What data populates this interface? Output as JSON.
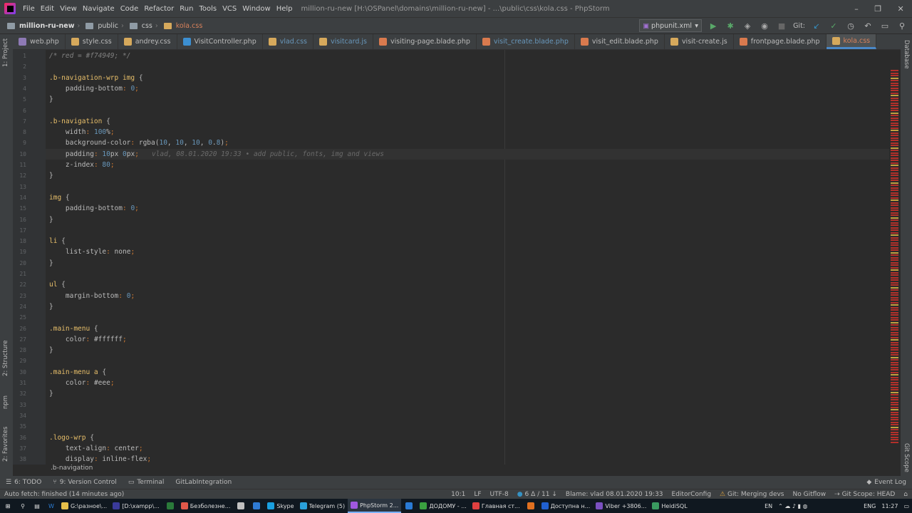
{
  "window": {
    "title": "million-ru-new [H:\\OSPanel\\domains\\million-ru-new] - ...\\public\\css\\kola.css - PhpStorm",
    "controls": [
      "–",
      "❐",
      "✕"
    ]
  },
  "menu": [
    "File",
    "Edit",
    "View",
    "Navigate",
    "Code",
    "Refactor",
    "Run",
    "Tools",
    "VCS",
    "Window",
    "Help"
  ],
  "breadcrumb": {
    "project": "million-ru-new",
    "dir1": "public",
    "dir2": "css",
    "file": "kola.css"
  },
  "run_config": {
    "label": "phpunit.xml",
    "git_label": "Git:"
  },
  "tabs": [
    {
      "label": "web.php",
      "color": "#8e7ab5"
    },
    {
      "label": "style.css",
      "color": "#d6a95c"
    },
    {
      "label": "andrey.css",
      "color": "#d6a95c"
    },
    {
      "label": "VisitController.php",
      "color": "#3c8fd1"
    },
    {
      "label": "vlad.css",
      "color": "#d6a95c"
    },
    {
      "label": "visitcard.js",
      "color": "#d6a95c"
    },
    {
      "label": "visiting-page.blade.php",
      "color": "#d97a4e"
    },
    {
      "label": "visit_create.blade.php",
      "color": "#d97a4e"
    },
    {
      "label": "visit_edit.blade.php",
      "color": "#d97a4e"
    },
    {
      "label": "visit-create.js",
      "color": "#d6a95c"
    },
    {
      "label": "frontpage.blade.php",
      "color": "#d97a4e"
    },
    {
      "label": "kola.css",
      "color": "#d6a95c"
    }
  ],
  "tab_colors": {
    "active_text": "#d9825b",
    "modified_text": "#6897bb"
  },
  "left_tools": [
    "1: Project",
    "2: Structure",
    "npm",
    "2: Favorites"
  ],
  "right_tools": [
    "Database",
    "Git Scope"
  ],
  "code_lines": [
    {
      "n": "1",
      "t": "/* red = #f74949; */"
    },
    {
      "n": "2",
      "t": ""
    },
    {
      "n": "3",
      "t": ".b-navigation-wrp img {"
    },
    {
      "n": "4",
      "t": "    padding-bottom: 0;"
    },
    {
      "n": "5",
      "t": "}"
    },
    {
      "n": "6",
      "t": ""
    },
    {
      "n": "7",
      "t": ".b-navigation {"
    },
    {
      "n": "8",
      "t": "    width: 100%;"
    },
    {
      "n": "9",
      "t": "    background-color: rgba(10, 10, 10, 0.8);"
    },
    {
      "n": "10",
      "t": "    padding: 10px 0px;",
      "blame": "vlad, 08.01.2020 19:33 • add public, fonts, img and views"
    },
    {
      "n": "11",
      "t": "    z-index: 80;"
    },
    {
      "n": "12",
      "t": "}"
    },
    {
      "n": "13",
      "t": ""
    },
    {
      "n": "14",
      "t": "img {"
    },
    {
      "n": "15",
      "t": "    padding-bottom: 0;"
    },
    {
      "n": "16",
      "t": "}"
    },
    {
      "n": "17",
      "t": ""
    },
    {
      "n": "18",
      "t": "li {"
    },
    {
      "n": "19",
      "t": "    list-style: none;"
    },
    {
      "n": "20",
      "t": "}"
    },
    {
      "n": "21",
      "t": ""
    },
    {
      "n": "22",
      "t": "ul {"
    },
    {
      "n": "23",
      "t": "    margin-bottom: 0;"
    },
    {
      "n": "24",
      "t": "}"
    },
    {
      "n": "25",
      "t": ""
    },
    {
      "n": "26",
      "t": ".main-menu {"
    },
    {
      "n": "27",
      "t": "    color: #ffffff;"
    },
    {
      "n": "28",
      "t": "}"
    },
    {
      "n": "29",
      "t": ""
    },
    {
      "n": "30",
      "t": ".main-menu a {"
    },
    {
      "n": "31",
      "t": "    color: #eee;"
    },
    {
      "n": "32",
      "t": "}"
    },
    {
      "n": "33",
      "t": ""
    },
    {
      "n": "34",
      "t": ""
    },
    {
      "n": "35",
      "t": ""
    },
    {
      "n": "36",
      "t": ".logo-wrp {"
    },
    {
      "n": "37",
      "t": "    text-align: center;"
    },
    {
      "n": "38",
      "t": "    display: inline-flex;"
    }
  ],
  "breadcrumb_context": ".b-navigation",
  "bottom_tools": [
    "6: TODO",
    "9: Version Control",
    "Terminal",
    "GitLabIntegration"
  ],
  "event_log": "Event Log",
  "status": {
    "message": "Auto fetch: finished (14 minutes ago)",
    "position": "10:1",
    "line_sep": "LF",
    "encoding": "UTF-8",
    "changes": "6 Δ / 11 ↓",
    "blame": "Blame: vlad 08.01.2020 19:33",
    "editorconfig": "EditorConfig",
    "git": "Git: Merging devs",
    "gitflow": "No Gitflow",
    "scope": "Git Scope: HEAD"
  },
  "taskbar": {
    "items": [
      {
        "label": "G:\\разное\\...",
        "color": "#e7c04a"
      },
      {
        "label": "[D:\\xampp\\...",
        "color": "#3a3a9a"
      },
      {
        "label": "",
        "color": "#2a7a3a"
      },
      {
        "label": "Безболезне...",
        "color": "#e0584a"
      },
      {
        "label": "",
        "color": "#c0c0c0"
      },
      {
        "label": "",
        "color": "#2f7bd4"
      },
      {
        "label": "Skype",
        "color": "#1aa0e0"
      },
      {
        "label": "Telegram (5)",
        "color": "#2aa0da"
      },
      {
        "label": "PhpStorm 2...",
        "color": "#a058e0"
      },
      {
        "label": "",
        "color": "#2a7ad4"
      },
      {
        "label": "ДОДОМУ - ...",
        "color": "#3aa040"
      },
      {
        "label": "Главная ст...",
        "color": "#e04040"
      },
      {
        "label": "",
        "color": "#e07020"
      },
      {
        "label": "Доступна н...",
        "color": "#2060d0"
      },
      {
        "label": "Viber +3806...",
        "color": "#7a50c0"
      },
      {
        "label": "HeidiSQL",
        "color": "#3a9a60"
      }
    ],
    "lang": "EN",
    "kb": "ENG",
    "time": "11:27"
  }
}
